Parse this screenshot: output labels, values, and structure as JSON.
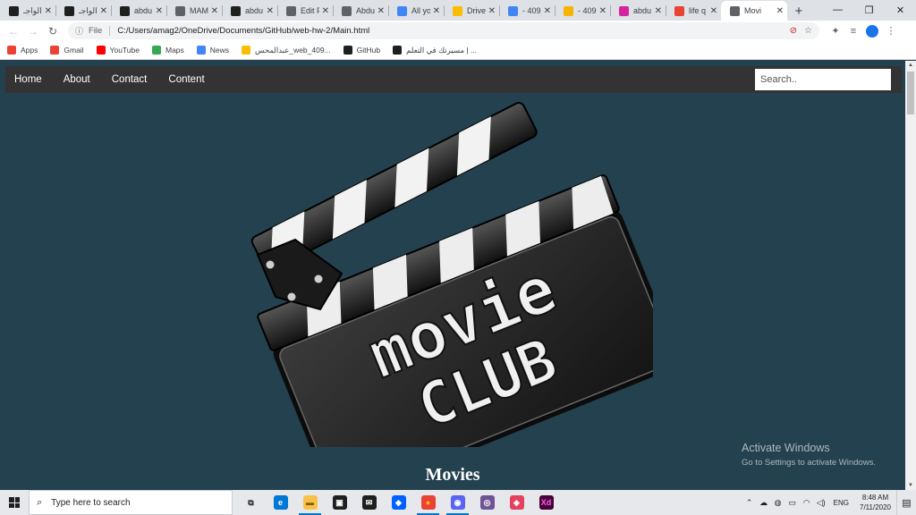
{
  "browser": {
    "tabs": [
      {
        "title": "الواجـ",
        "favicon": "blackdoc",
        "color": "#1f1f1f"
      },
      {
        "title": "الواجـ",
        "favicon": "blackdoc",
        "color": "#1f1f1f"
      },
      {
        "title": "abdu",
        "favicon": "github",
        "color": "#1f1f1f"
      },
      {
        "title": "MAM",
        "favicon": "globe",
        "color": "#5f6368"
      },
      {
        "title": "abdu",
        "favicon": "github",
        "color": "#1f1f1f"
      },
      {
        "title": "Edit F",
        "favicon": "globe",
        "color": "#5f6368"
      },
      {
        "title": "Abdu",
        "favicon": "globe",
        "color": "#5f6368"
      },
      {
        "title": "All yo",
        "favicon": "google",
        "color": "#4285f4"
      },
      {
        "title": "Drive",
        "favicon": "drive",
        "color": "#fbbc04"
      },
      {
        "title": "- 409",
        "favicon": "docs",
        "color": "#4285f4"
      },
      {
        "title": "- 409",
        "favicon": "slides",
        "color": "#f4b400"
      },
      {
        "title": "abdu",
        "favicon": "instagram",
        "color": "#d6249f"
      },
      {
        "title": "life q",
        "favicon": "gmail",
        "color": "#ea4335"
      },
      {
        "title": "Movi",
        "favicon": "globe",
        "color": "#5f6368",
        "active": true
      }
    ],
    "new_tab": "+",
    "window_controls": {
      "minimize": "—",
      "maximize": "❐",
      "close": "✕"
    },
    "address": {
      "scheme": "File",
      "url": "C:/Users/amag2/OneDrive/Documents/GitHub/web-hw-2/Main.html"
    },
    "bookmarks": [
      {
        "label": "Apps",
        "icon": "apps-grid-icon",
        "color": "#ea4335"
      },
      {
        "label": "Gmail",
        "icon": "gmail-icon",
        "color": "#ea4335"
      },
      {
        "label": "YouTube",
        "icon": "youtube-icon",
        "color": "#ff0000"
      },
      {
        "label": "Maps",
        "icon": "maps-icon",
        "color": "#34a853"
      },
      {
        "label": "News",
        "icon": "news-icon",
        "color": "#4285f4"
      },
      {
        "label": "عبدالمحس_web_409...",
        "icon": "drive-icon",
        "color": "#fbbc04"
      },
      {
        "label": "GitHub",
        "icon": "github-icon",
        "color": "#1f1f1f"
      },
      {
        "label": "مسيرتك في التعلم | ...",
        "icon": "blackdoc-icon",
        "color": "#1f1f1f"
      }
    ]
  },
  "site": {
    "nav": [
      {
        "label": "Home"
      },
      {
        "label": "About"
      },
      {
        "label": "Contact"
      },
      {
        "label": "Content"
      }
    ],
    "search_placeholder": "Search..",
    "logo": {
      "line1": "movie",
      "line2": "CLUB"
    },
    "movies_heading": "Movies"
  },
  "watermark": {
    "line1": "Activate Windows",
    "line2": "Go to Settings to activate Windows."
  },
  "taskbar": {
    "search_placeholder": "Type here to search",
    "apps": [
      {
        "name": "task-view",
        "glyph": "⧉",
        "color": "#e6e8ec",
        "fg": "#1f1f1f"
      },
      {
        "name": "edge",
        "glyph": "e",
        "color": "#0078d4",
        "fg": "#fff"
      },
      {
        "name": "file-explorer",
        "glyph": "▬",
        "color": "#f8c24a",
        "fg": "#8a5a00",
        "running": true
      },
      {
        "name": "store",
        "glyph": "▣",
        "color": "#1f1f1f",
        "fg": "#fff"
      },
      {
        "name": "mail",
        "glyph": "✉",
        "color": "#1f1f1f",
        "fg": "#fff"
      },
      {
        "name": "dropbox",
        "glyph": "◆",
        "color": "#0061ff",
        "fg": "#fff"
      },
      {
        "name": "chrome",
        "glyph": "●",
        "color": "#ea4335",
        "fg": "#fbbc04",
        "running": true
      },
      {
        "name": "discord",
        "glyph": "◉",
        "color": "#5865f2",
        "fg": "#fff",
        "running": true
      },
      {
        "name": "github-desktop",
        "glyph": "◎",
        "color": "#6e5494",
        "fg": "#fff"
      },
      {
        "name": "photos",
        "glyph": "◈",
        "color": "#e4405f",
        "fg": "#fff"
      },
      {
        "name": "adobe-xd",
        "glyph": "Xd",
        "color": "#470137",
        "fg": "#ff61f6"
      }
    ],
    "tray_lang": "ENG",
    "time": "8:48 AM",
    "date": "7/11/2020"
  }
}
